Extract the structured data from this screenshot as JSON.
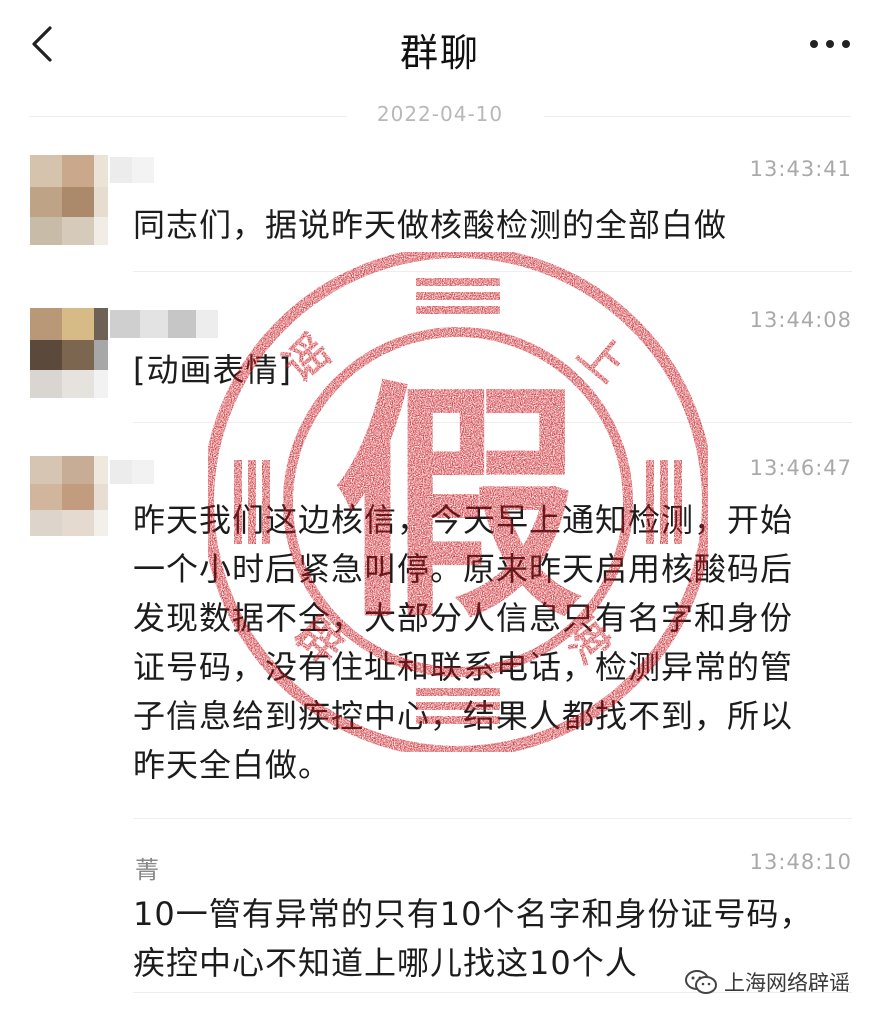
{
  "header": {
    "title": "群聊",
    "back_icon": "chevron-left-icon",
    "more_icon": "more-dots-icon"
  },
  "date_separator": "2022-04-10",
  "messages": [
    {
      "time": "13:43:41",
      "text": "同志们，据说昨天做核酸检测的全部白做"
    },
    {
      "time": "13:44:08",
      "text": "[动画表情]"
    },
    {
      "time": "13:46:47",
      "lines": [
        "昨天我们这边核信，今天早上通知检测，开始",
        "一个小时后紧急叫停。原来昨天启用核酸码后",
        "发现数据不全，大部分人信息只有名字和身份",
        "证号码，没有住址和联系电话，检测异常的管",
        "子信息给到疾控中心，结果人都找不到，所以",
        "昨天全白做。"
      ]
    },
    {
      "sender": "菁",
      "time": "13:48:10",
      "lines": [
        "10一管有异常的只有10个名字和身份证号码，",
        "疾控中心不知道上哪儿找这10个人"
      ]
    }
  ],
  "stamp": {
    "center_char": "假",
    "ring_chars": [
      "谣",
      "上",
      "海",
      "辟"
    ],
    "color": "#c8161d"
  },
  "watermark": {
    "text": "上海网络辟谣",
    "icon": "wechat-official-icon"
  }
}
